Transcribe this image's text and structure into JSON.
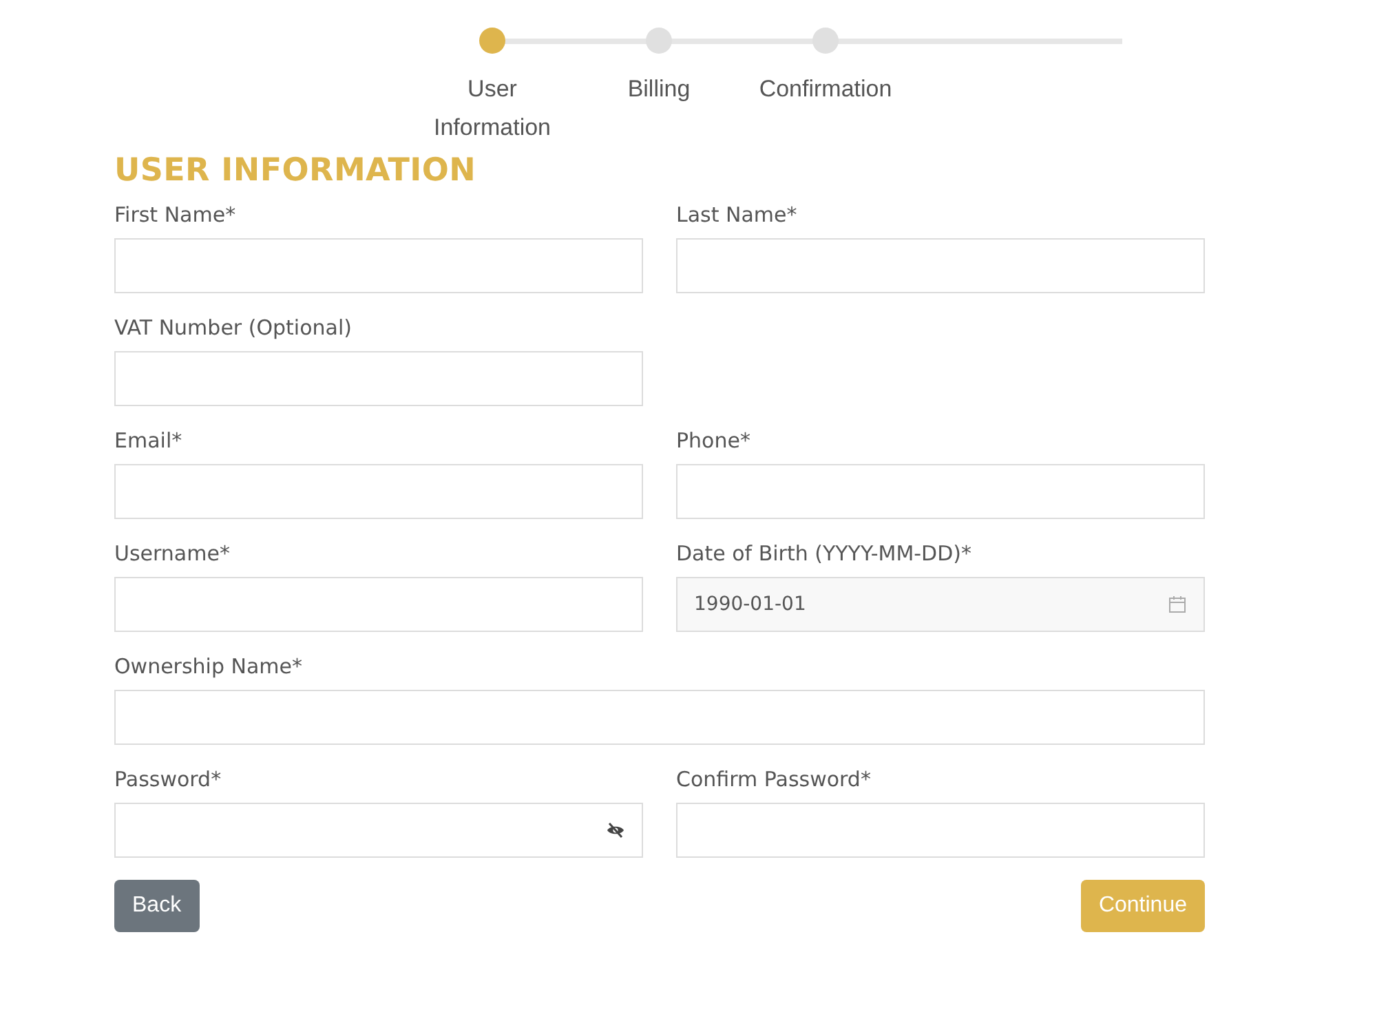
{
  "steps": [
    {
      "label": "User Information",
      "selected": true
    },
    {
      "label": "Billing",
      "selected": false
    },
    {
      "label": "Confirmation",
      "selected": false
    }
  ],
  "heading": "USER INFORMATION",
  "rows": [
    [
      {
        "label": "First Name*",
        "kind": "text"
      },
      {
        "label": "Last Name*",
        "kind": "text"
      }
    ],
    [
      {
        "label": "VAT Number (Optional)",
        "kind": "text"
      }
    ],
    [
      {
        "label": "Email*",
        "kind": "text"
      },
      {
        "label": "Phone*",
        "kind": "text"
      }
    ],
    [
      {
        "label": "Username*",
        "kind": "text"
      },
      {
        "label": "Date of Birth (YYYY-MM-DD)*",
        "kind": "date",
        "value": "1990-01-01"
      }
    ],
    [
      {
        "label": "Ownership Name*",
        "kind": "full"
      }
    ],
    [
      {
        "label": "Password*",
        "kind": "password"
      },
      {
        "label": "Confirm Password*",
        "kind": "text"
      }
    ]
  ],
  "buttons": {
    "back": "Back",
    "continue": "Continue"
  }
}
